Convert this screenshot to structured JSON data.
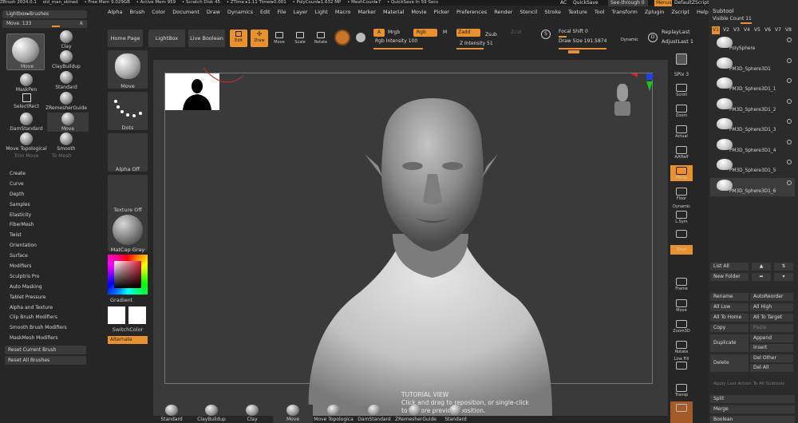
{
  "titlebar": {
    "app": "ZBrush 2024.0.1",
    "doc": "old_man_skined",
    "free_mem": "• Free Mem 9.029GB",
    "active_mem": "• Active Mem 959",
    "scratch": "• Scratch Disk 45",
    "ztime": "• ZTime ▸1.11 Timer▸0.001",
    "poly": "• PolyCount▸1.632 MP",
    "mesh": "• MeshCount▸7",
    "quicksave": "• QuickSave In 59 Secs"
  },
  "topright": {
    "ac": "AC",
    "quicksave": "QuickSave",
    "seethrough": "See-through 0",
    "menus": "Menus",
    "script": "DefaultZScript"
  },
  "menubar": [
    "Alpha",
    "Brush",
    "Color",
    "Document",
    "Draw",
    "Dynamics",
    "Edit",
    "File",
    "Layer",
    "Light",
    "Macro",
    "Marker",
    "Material",
    "Movie",
    "Picker",
    "Preferences",
    "Render",
    "Stencil",
    "Stroke",
    "Texture",
    "Tool",
    "Transform",
    "Zplugin",
    "Zscript",
    "Help"
  ],
  "leftpanel": {
    "lightbox_brushes": "Lightbox▸Brushes",
    "move_label": "Move. 133",
    "r": "R",
    "brushes": [
      "Move",
      "Clay",
      "ClayBuildup",
      "MaskPen",
      "Standard",
      "SelectRect",
      "ZRemesherGuide",
      "DamStandard",
      "Move",
      "Move Topological",
      "Smooth",
      "Trim Move",
      "To Mesh"
    ],
    "menu": [
      "Create",
      "Curve",
      "Depth",
      "Samples",
      "Elasticity",
      "FiberMesh",
      "Twist",
      "Orientation",
      "Surface",
      "Modifiers",
      "Sculptris Pro",
      "Auto Masking",
      "Tablet Pressure",
      "Alpha and Texture",
      "Clip Brush Modifiers",
      "Smooth Brush Modifiers",
      "MaskMesh Modifiers"
    ],
    "reset_current": "Reset Current Brush",
    "reset_all": "Reset All Brushes"
  },
  "shelf": {
    "home": "Home Page",
    "lightbox": "LightBox",
    "live_boolean": "Live Boolean",
    "edit": "Edit",
    "draw": "Draw",
    "move": "Move",
    "scale": "Scale",
    "rotate": "Rotate",
    "a": "A",
    "mrgb": "Mrgb",
    "rgb": "Rgb",
    "m": "M",
    "zadd": "Zadd",
    "zsub": "Zsub",
    "zcut": "Zcut",
    "rgb_intensity": "Rgb Intensity 100",
    "z_intensity": "Z Intensity 51",
    "s": "S",
    "focal_shift": "Focal Shift 0",
    "draw_size": "Draw Size 191.5874",
    "dynamic": "Dynamic",
    "d": "D",
    "replay_last": "ReplayLast",
    "adjust_last": "AdjustLast 1"
  },
  "lefttray": {
    "move": "Move",
    "dots": "Dots",
    "alpha_off": "Alpha Off",
    "texture_off": "Texture Off",
    "matcap": "MatCap Gray",
    "gradient": "Gradient",
    "switchcolor": "SwitchColor",
    "alternate": "Alternate"
  },
  "righttray": {
    "bpr": "BPR",
    "spix": "SPix 3",
    "scroll": "Scroll",
    "zoom": "Zoom",
    "actual": "Actual",
    "aahalf": "AAHalf",
    "persp": "Persp",
    "floor": "Floor",
    "dynamic": "Dynamic",
    "lsym": "L.Sym",
    "xyz": "Qxyz",
    "frame": "Frame",
    "move": "Move",
    "zoom3d": "Zoom3D",
    "rotate": "Rotate",
    "linefill": "Line Fill",
    "polyf": "PolyF",
    "transp": "Transp",
    "ghost": "Ghost"
  },
  "subtool": {
    "title": "Subtool",
    "visible": "Visible Count 11",
    "versions": [
      "V1",
      "V2",
      "V3",
      "V4",
      "V5",
      "V6",
      "V7",
      "V8"
    ],
    "items": [
      "PolySphere",
      "PM3D_Sphere3D1",
      "PM3D_Sphere3D1_1",
      "PM3D_Sphere3D1_2",
      "PM3D_Sphere3D1_3",
      "PM3D_Sphere3D1_4",
      "PM3D_Sphere3D1_5",
      "PM3D_Sphere3D1_6"
    ],
    "list_all": "List All",
    "new_folder": "New Folder",
    "rename": "Rename",
    "autoreorder": "AutoReorder",
    "all_low": "All Low",
    "all_high": "All High",
    "all_to_home": "All To Home",
    "all_to_target": "All To Target",
    "copy": "Copy",
    "paste": "Paste",
    "duplicate": "Duplicate",
    "append": "Append",
    "insert": "Insert",
    "delete": "Delete",
    "del_other": "Del Other",
    "del_all": "Del All",
    "apply_last": "Apply Last Action To All Subtools",
    "split": "Split",
    "merge": "Merge",
    "boolean": "Boolean"
  },
  "bottomshelf": [
    "Standard",
    "ClayBuildup",
    "Clay",
    "Move",
    "Move Topologica",
    "DamStandard",
    "ZRemesherGuide",
    "Standard"
  ],
  "tutorial": {
    "title": "TUTORIAL VIEW",
    "line1": "Click and drag to reposition, or single-click",
    "line2": "to restore previous position."
  },
  "colors": {
    "accent": "#e8912e",
    "bg": "#262626"
  }
}
